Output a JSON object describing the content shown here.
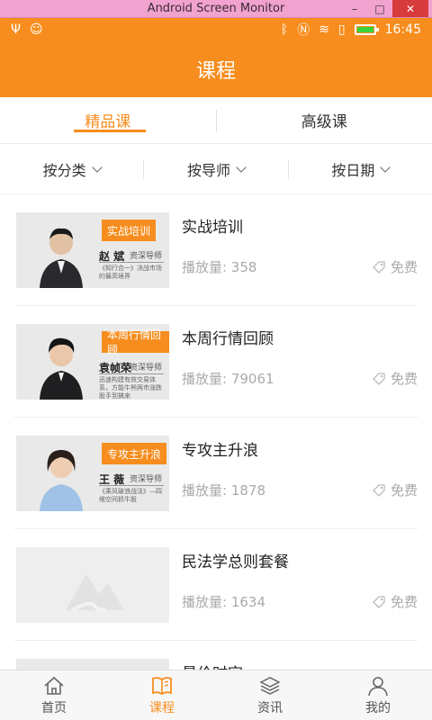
{
  "window": {
    "title": "Android Screen Monitor",
    "minimize": "–",
    "maximize": "□",
    "close": "✕"
  },
  "status": {
    "time": "16:45"
  },
  "header": {
    "title": "课程"
  },
  "tabs": [
    {
      "label": "精品课"
    },
    {
      "label": "高级课"
    }
  ],
  "filters": [
    {
      "label": "按分类"
    },
    {
      "label": "按导师"
    },
    {
      "label": "按日期"
    }
  ],
  "courses": [
    {
      "title": "实战培训",
      "plays": "播放量: 358",
      "price": "免费",
      "thumb": {
        "tag": "实战培训",
        "name": "赵 斌",
        "role": "资深导师",
        "desc": "《知行合一》决战市场的最高境界"
      }
    },
    {
      "title": "本周行情回顾",
      "plays": "播放量: 79061",
      "price": "免费",
      "thumb": {
        "tag": "本周行情回顾",
        "name": "袁帧荣",
        "role": "资深导师",
        "desc": "迅速构建有效交易体系，方能牛熊两市涨跌股手到擒来"
      }
    },
    {
      "title": "专攻主升浪",
      "plays": "播放量: 1878",
      "price": "免费",
      "thumb": {
        "tag": "专攻主升浪",
        "name": "王 薇",
        "role": "资深导师",
        "desc": "《乘风破浪战法》—四维空间抓牛股"
      }
    },
    {
      "title": "民法学总则套餐",
      "plays": "播放量: 1634",
      "price": "免费"
    },
    {
      "title": "最价时空"
    }
  ],
  "bottom_nav": [
    {
      "label": "首页",
      "icon": "home-icon"
    },
    {
      "label": "课程",
      "icon": "book-icon"
    },
    {
      "label": "资讯",
      "icon": "news-stack-icon"
    },
    {
      "label": "我的",
      "icon": "profile-icon"
    }
  ],
  "colors": {
    "accent": "#f78d1e",
    "muted": "#aaaaaa"
  }
}
